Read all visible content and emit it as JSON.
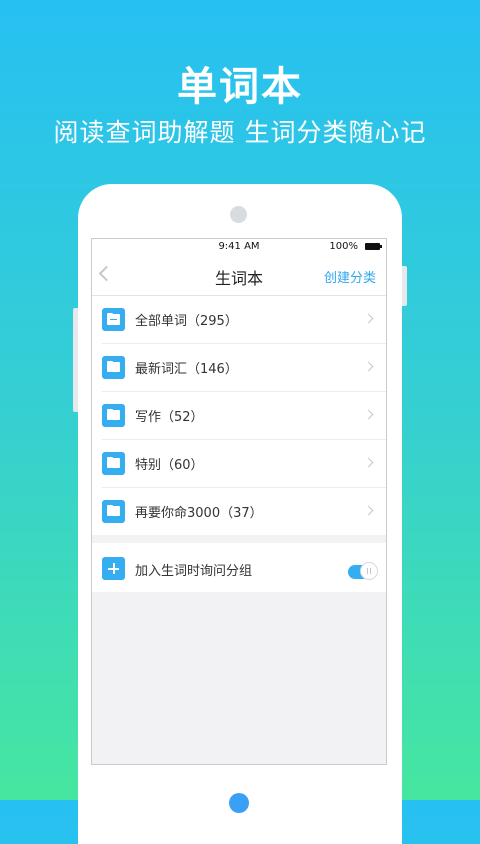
{
  "promo": {
    "headline": "单词本",
    "subline": "阅读查词助解题 生词分类随心记"
  },
  "status": {
    "time": "9:41 AM",
    "battery": "100%"
  },
  "nav": {
    "title": "生词本",
    "action": "创建分类",
    "back_icon": "chevron-left-icon"
  },
  "folders": [
    {
      "label": "全部单词（295）",
      "icon": "document-folder-icon"
    },
    {
      "label": "最新词汇（146）",
      "icon": "folder-icon"
    },
    {
      "label": "写作（52）",
      "icon": "folder-icon"
    },
    {
      "label": "特别（60）",
      "icon": "folder-icon"
    },
    {
      "label": "再要你命3000（37）",
      "icon": "folder-icon"
    }
  ],
  "setting": {
    "label": "加入生词时询问分组",
    "icon": "plus-icon",
    "enabled": true
  },
  "colors": {
    "accent": "#35aef1",
    "bg_top": "#27c0f2",
    "bg_bottom": "#46e6a0"
  }
}
